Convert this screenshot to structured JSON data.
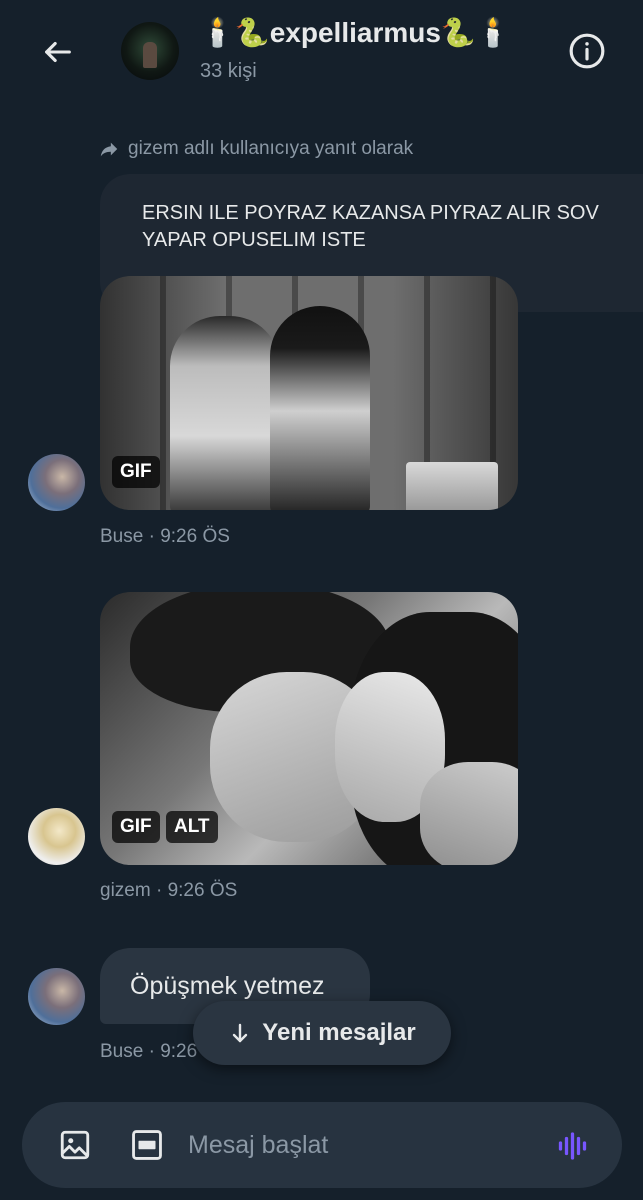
{
  "header": {
    "title": "🕯️🐍expelliarmus🐍🕯️",
    "member_count": "33 kişi",
    "icons": {
      "back": "arrow-left-icon",
      "info": "info-icon"
    }
  },
  "messages": {
    "reply_context": "gizem adlı kullanıcıya yanıt olarak",
    "quoted_text_line1": "ERSIN ILE POYRAZ KAZANSA PIYRAZ ALIR SOV",
    "quoted_text_line2": "YAPAR OPUSELIM ISTE",
    "gif1": {
      "badge": "GIF"
    },
    "meta1": "Buse · 9:26 ÖS",
    "gif2": {
      "badge_gif": "GIF",
      "badge_alt": "ALT"
    },
    "meta2": "gizem · 9:26 ÖS",
    "text_message": "Öpüşmek yetmez",
    "meta3": "Buse · 9:26"
  },
  "new_messages_pill": {
    "label": "Yeni mesajlar"
  },
  "composer": {
    "placeholder": "Mesaj başlat",
    "icons": {
      "image": "image-icon",
      "gif": "gif-icon",
      "voice": "voice-wave-icon"
    }
  },
  "colors": {
    "background": "#15202b",
    "bubble": "#2a3541",
    "muted_text": "#8b98a5",
    "voice_accent": "#7856ff"
  }
}
